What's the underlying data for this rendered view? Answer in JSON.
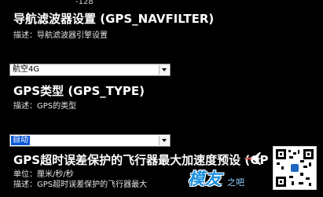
{
  "top_partial_text": "-128",
  "params": [
    {
      "title": "导航滤波器设置 (GPS_NAVFILTER)",
      "description": "描述：导航滤波器引擎设置"
    },
    {
      "title": "GPS类型 (GPS_TYPE)",
      "description": "描述：GPS的类型"
    },
    {
      "title": "GPS超时误差保护的飞行器最大加速度预设 (GP",
      "unit": "单位：厘米/秒/秒",
      "description": "描述：GPS超时误差保护的飞行器最大"
    }
  ],
  "selects": [
    {
      "value": "航空4G",
      "highlighted": false
    },
    {
      "value": "自动",
      "highlighted": true
    }
  ],
  "watermark": {
    "text": "模友",
    "sub": "之吧"
  },
  "colors": {
    "background": "#000000",
    "text": "#ffffff",
    "select_highlight": "#0a59d6",
    "watermark": "#1b8fe0"
  },
  "icons": [
    "chevron-down-icon",
    "plane-icon",
    "qr-code-icon"
  ]
}
